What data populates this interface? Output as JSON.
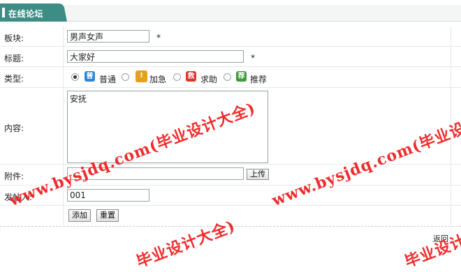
{
  "header": {
    "title": "在线论坛"
  },
  "form": {
    "board_label": "板块:",
    "board_value": "男声女声",
    "title_label": "标题:",
    "title_value": "大家好",
    "required_mark": "*",
    "type_label": "类型:",
    "types": [
      {
        "label": "普通",
        "icon_char": "普",
        "icon_color": "#2f86d6",
        "selected": true
      },
      {
        "label": "加急",
        "icon_char": "!",
        "icon_color": "#e3a11c",
        "selected": false
      },
      {
        "label": "求助",
        "icon_char": "救",
        "icon_color": "#d83a2a",
        "selected": false
      },
      {
        "label": "推荐",
        "icon_char": "荐",
        "icon_color": "#3e9b3c",
        "selected": false
      }
    ],
    "content_label": "内容:",
    "content_value": "安抚",
    "attachment_label": "附件:",
    "attachment_value": "",
    "upload_label": "上传",
    "poster_label": "发帖人:",
    "poster_value": "001",
    "add_label": "添加",
    "reset_label": "重置"
  },
  "back_label": "返回",
  "watermarks": [
    "www.bysjdq.com(毕业设计大全)",
    "www.bysjdq.com(毕业设计大全)",
    "毕业设计大全)",
    "毕业设计"
  ],
  "colors": {
    "header_tab": "#3d8d86",
    "watermark": "#ee1b1b"
  }
}
